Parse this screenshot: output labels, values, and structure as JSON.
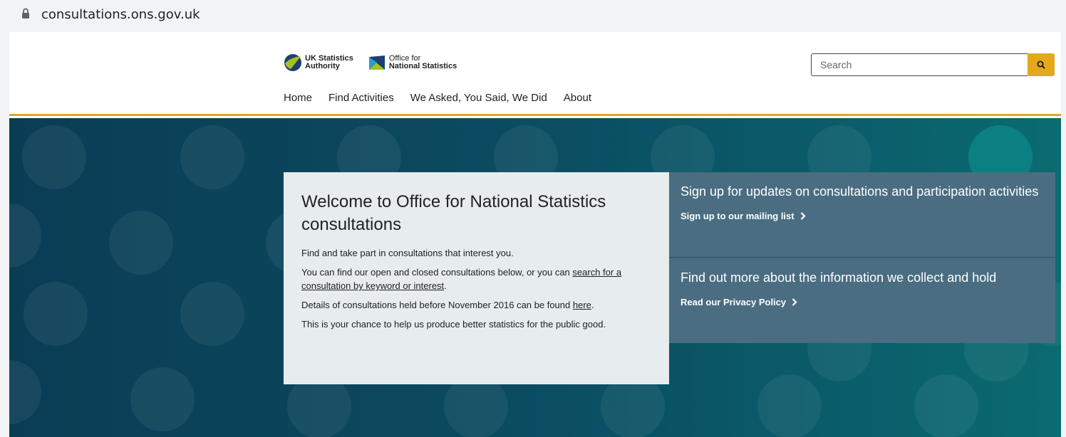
{
  "browser": {
    "url": "consultations.ons.gov.uk"
  },
  "header": {
    "logo_uksa": {
      "line1": "UK Statistics",
      "line2": "Authority"
    },
    "logo_ons": {
      "line1": "Office for",
      "line2": "National Statistics"
    },
    "search": {
      "placeholder": "Search"
    },
    "nav": [
      "Home",
      "Find Activities",
      "We Asked, You Said, We Did",
      "About"
    ],
    "colors": {
      "accent": "#e1a723"
    }
  },
  "hero": {
    "welcome": {
      "title": "Welcome to Office for National Statistics consultations",
      "p1": "Find and take part in consultations that interest you.",
      "p2_before": "You can find our open and closed consultations below, or you can ",
      "p2_link": "search for a consultation by keyword or interest",
      "p2_after": ".",
      "p3_before": "Details of consultations held before November 2016 can be found ",
      "p3_link": "here",
      "p3_after": ".",
      "p4": "This is your chance to help us produce better statistics for the public good."
    },
    "signup": {
      "heading": "Sign up for updates on consultations and participation activities",
      "link": "Sign up to our mailing list"
    },
    "privacy": {
      "heading": "Find out more about the information we collect and hold",
      "link": "Read our Privacy Policy"
    }
  }
}
